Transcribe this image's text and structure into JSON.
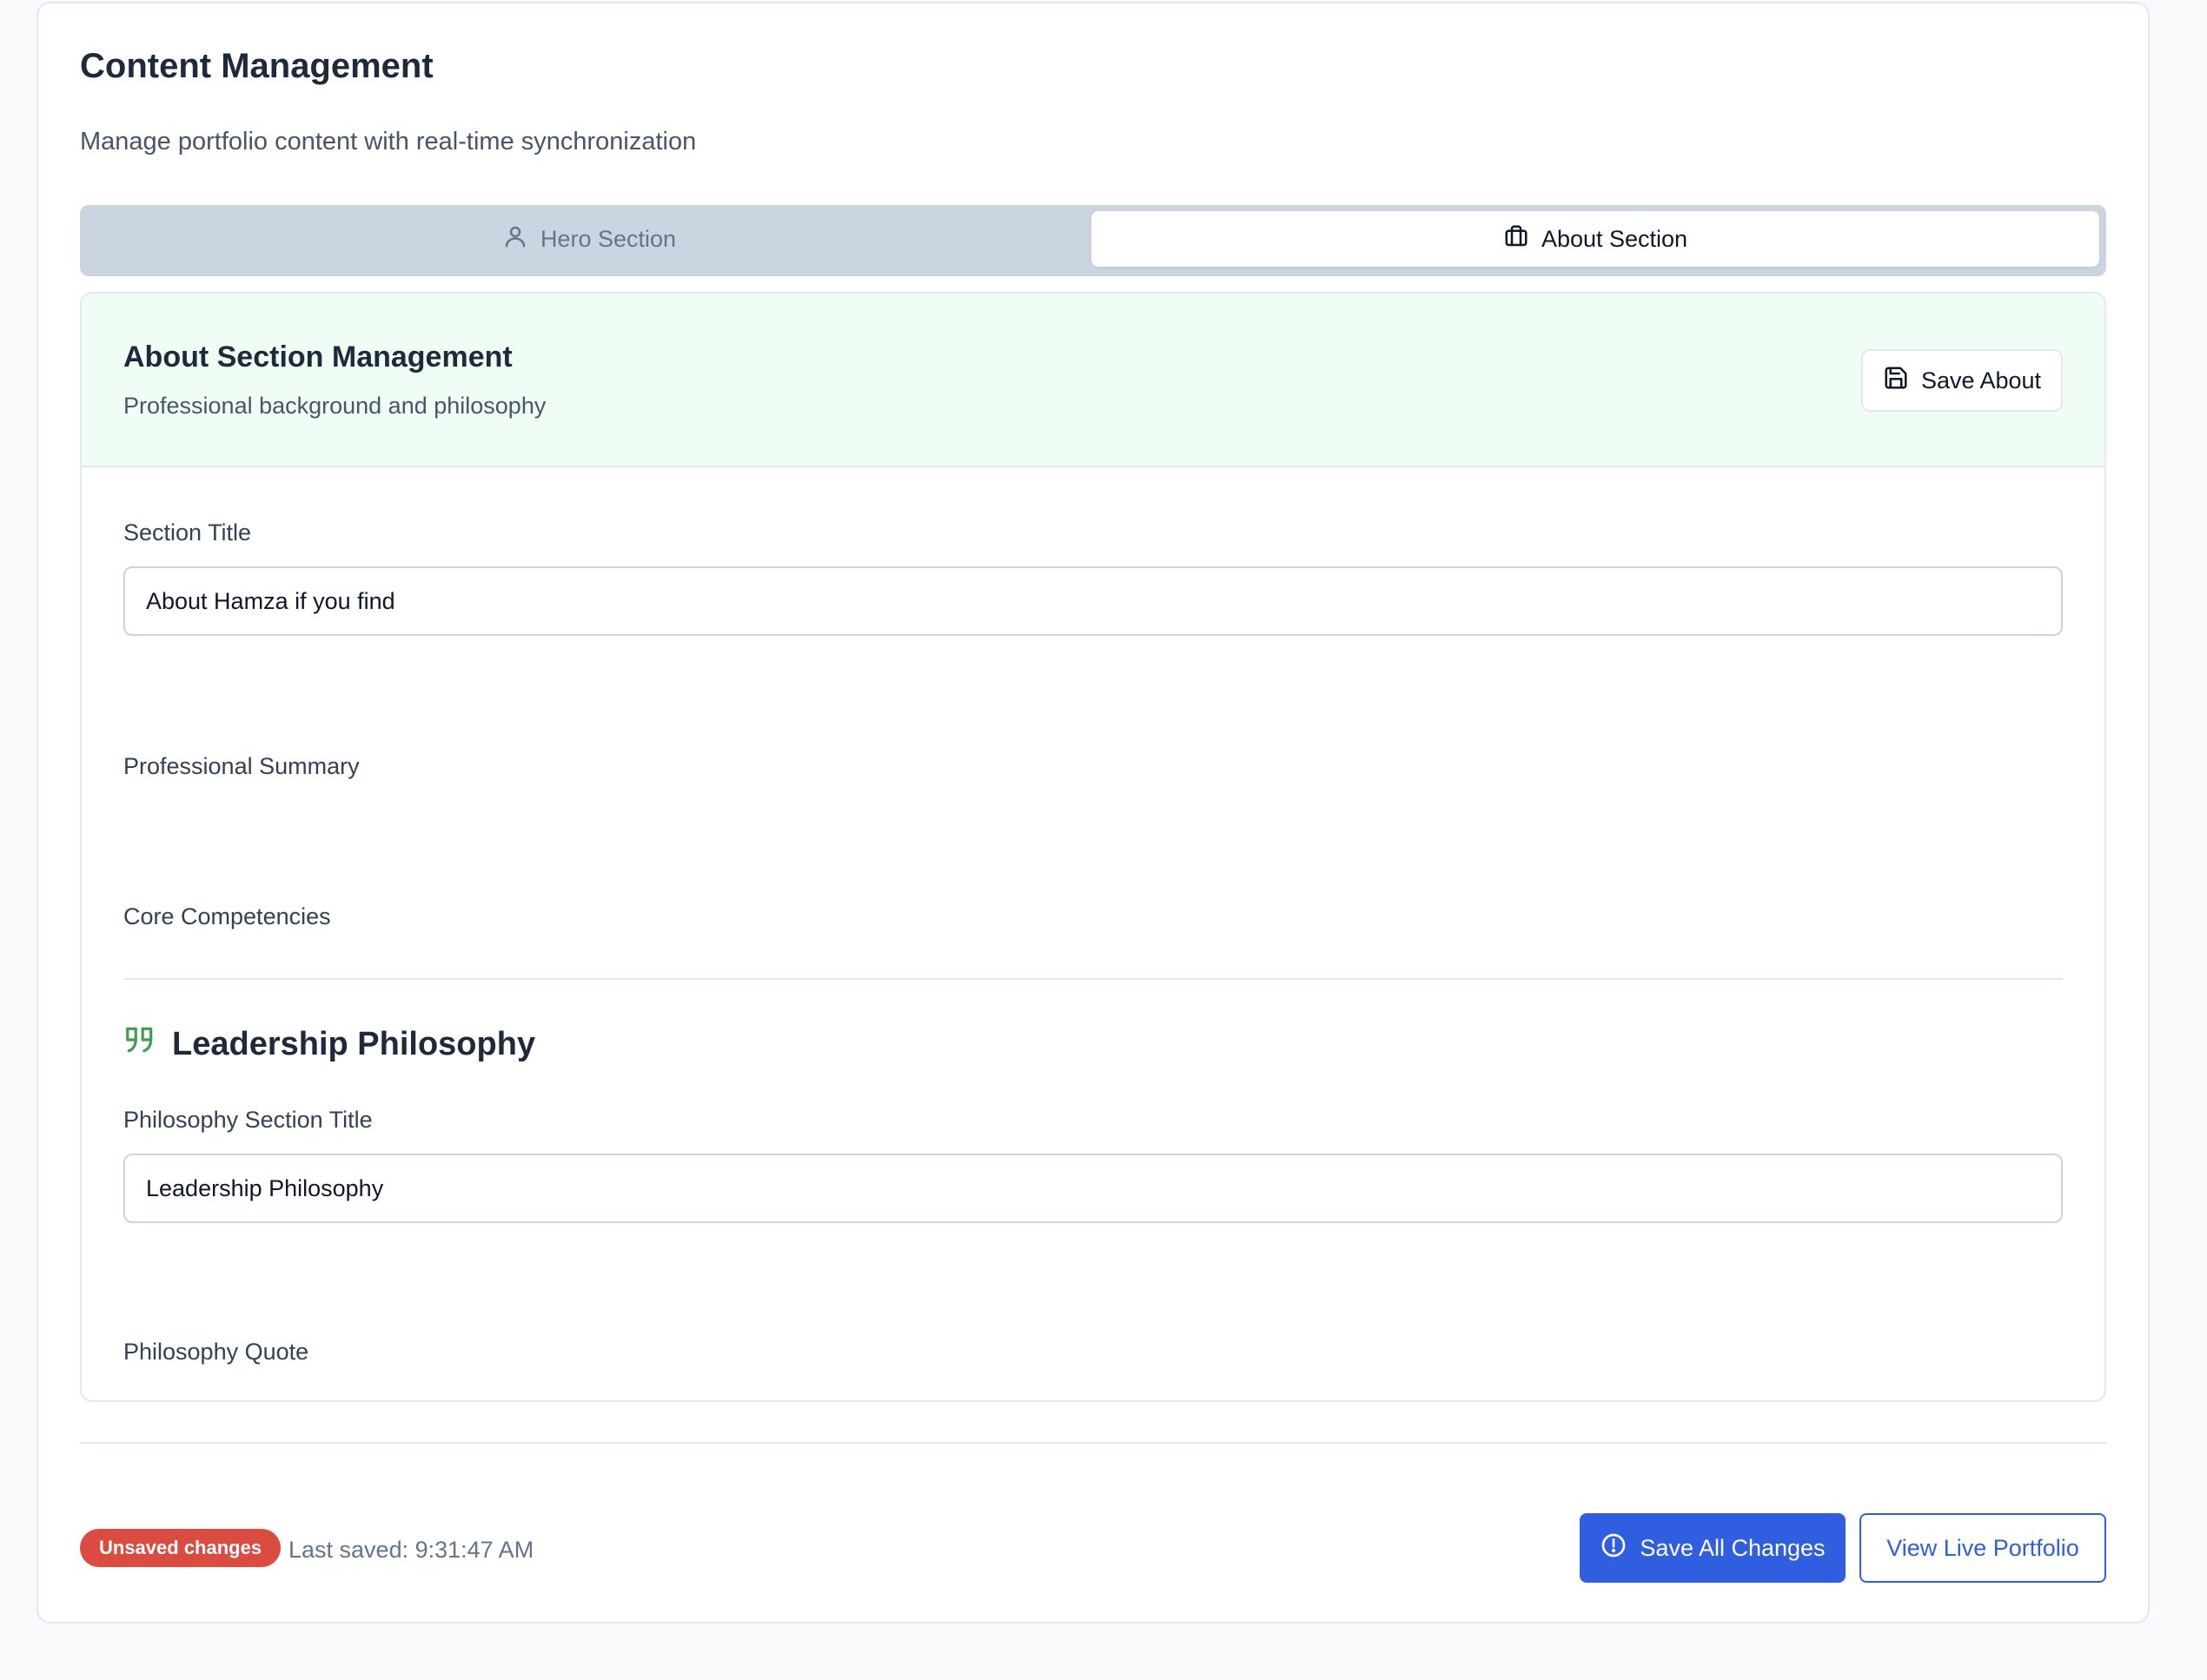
{
  "header": {
    "title": "Content Management",
    "subtitle": "Manage portfolio content with real-time synchronization"
  },
  "tabs": [
    {
      "label": "Hero Section",
      "icon": "user-icon",
      "active": false
    },
    {
      "label": "About Section",
      "icon": "briefcase-icon",
      "active": true
    }
  ],
  "about_panel": {
    "title": "About Section Management",
    "subtitle": "Professional background and philosophy",
    "save_label": "Save About",
    "fields": {
      "section_title_label": "Section Title",
      "section_title_value": "About Hamza if you find",
      "professional_summary_label": "Professional Summary",
      "core_competencies_label": "Core Competencies"
    },
    "philosophy": {
      "heading": "Leadership Philosophy",
      "title_label": "Philosophy Section Title",
      "title_value": "Leadership Philosophy",
      "quote_label": "Philosophy Quote"
    }
  },
  "footer": {
    "status_badge": "Unsaved changes",
    "last_saved": "Last saved: 9:31:47 AM",
    "save_all_label": "Save All Changes",
    "view_live_label": "View Live Portfolio"
  },
  "colors": {
    "accent": "#2f5ee0",
    "badge": "#dc4b3f",
    "panel_header_bg": "#f0fdf4",
    "quote_icon": "#3f9d4f"
  }
}
